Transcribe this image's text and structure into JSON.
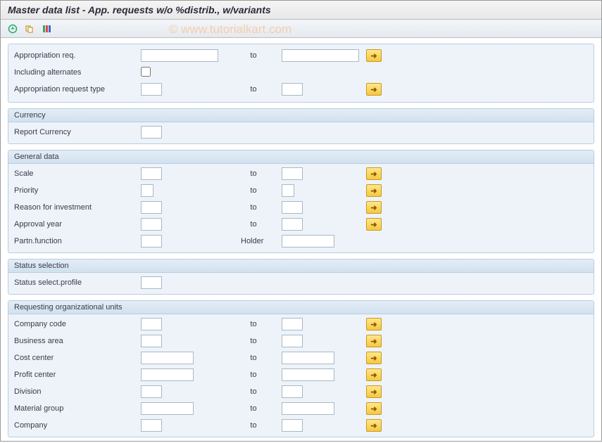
{
  "title": "Master data list - App. requests w/o %distrib., w/variants",
  "watermark": "© www.tutorialkart.com",
  "to_label": "to",
  "block1": {
    "appr_req": "Appropriation req.",
    "incl_alt": "Including alternates",
    "appr_type": "Appropriation request type"
  },
  "group_currency": {
    "title": "Currency",
    "report_currency": "Report Currency"
  },
  "group_general": {
    "title": "General data",
    "scale": "Scale",
    "priority": "Priority",
    "reason": "Reason for investment",
    "approval_year": "Approval year",
    "partn_function": "Partn.function",
    "holder": "Holder"
  },
  "group_status": {
    "title": "Status selection",
    "profile": "Status select.profile"
  },
  "group_org": {
    "title": "Requesting organizational units",
    "company_code": "Company code",
    "business_area": "Business area",
    "cost_center": "Cost center",
    "profit_center": "Profit center",
    "division": "Division",
    "material_group": "Material group",
    "company": "Company"
  }
}
